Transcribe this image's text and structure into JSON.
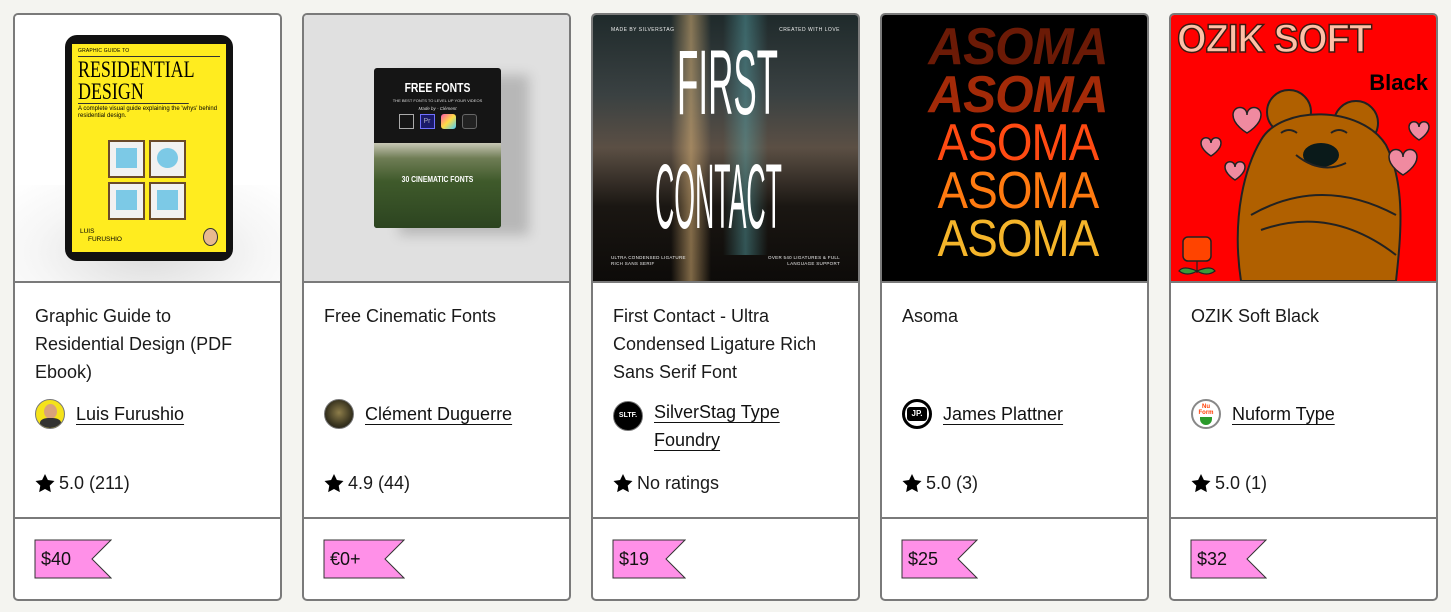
{
  "accent": {
    "price_tag": "#ff90e8",
    "border": "#7a7a7a",
    "page_bg": "#f4f4f0"
  },
  "products": [
    {
      "title": "Graphic Guide to Residential Design (PDF Ebook)",
      "creator": "Luis Furushio",
      "rating_icon": "star-icon",
      "rating_text": "5.0 (211)",
      "price": "$40",
      "cover": {
        "bg": "#ffffff",
        "kicker": "GRAPHIC GUIDE TO",
        "headline1": "RESIDENTIAL",
        "headline2": "DESIGN",
        "sub": "A complete visual guide explaining the 'whys' behind residential design.",
        "author1": "LUIS",
        "author2": "FURUSHIO"
      }
    },
    {
      "title": "Free Cinematic Fonts",
      "creator": "Clément Duguerre",
      "rating_icon": "star-icon",
      "rating_text": "4.9 (44)",
      "price": "€0+",
      "cover": {
        "bg": "#e0e0e0",
        "headline": "FREE FONTS",
        "sub": "THE BEST FONTS TO LEVEL UP YOUR VIDEOS",
        "sign": "Made by - Clément",
        "apps": [
          "Pr",
          "",
          "",
          ""
        ],
        "bottom": "30 CINEMATIC FONTS"
      }
    },
    {
      "title": "First Contact - Ultra Condensed Ligature Rich Sans Serif Font",
      "creator": "SilverStag Type Foundry",
      "rating_icon": "star-icon",
      "rating_text": "No ratings",
      "price": "$19",
      "cover": {
        "top_left": "MADE BY SILVERSTAG",
        "top_right": "CREATED WITH LOVE",
        "line1": "FIRST",
        "line2": "CONTACT",
        "bottom_left": "ULTRA CONDENSED LIGATURE RICH SANS SERIF",
        "bottom_right": "OVER 540 LIGATURES & FULL LANGUAGE SUPPORT"
      },
      "avatar_text": "SLTF."
    },
    {
      "title": "Asoma",
      "creator": "James Plattner",
      "rating_icon": "star-icon",
      "rating_text": "5.0 (3)",
      "price": "$25",
      "cover": {
        "word": "ASOMA",
        "colors": [
          "#6b1a06",
          "#a32a08",
          "#ff4a12",
          "#ff7a10",
          "#f5b52a"
        ]
      },
      "avatar_text": "JP."
    },
    {
      "title": "OZIK Soft Black",
      "creator": "Nuform Type",
      "rating_icon": "star-icon",
      "rating_text": "5.0 (1)",
      "price": "$32",
      "cover": {
        "headline": "OZIK SOFT",
        "sub": "Black"
      },
      "avatar_text": "Nu Form"
    }
  ]
}
